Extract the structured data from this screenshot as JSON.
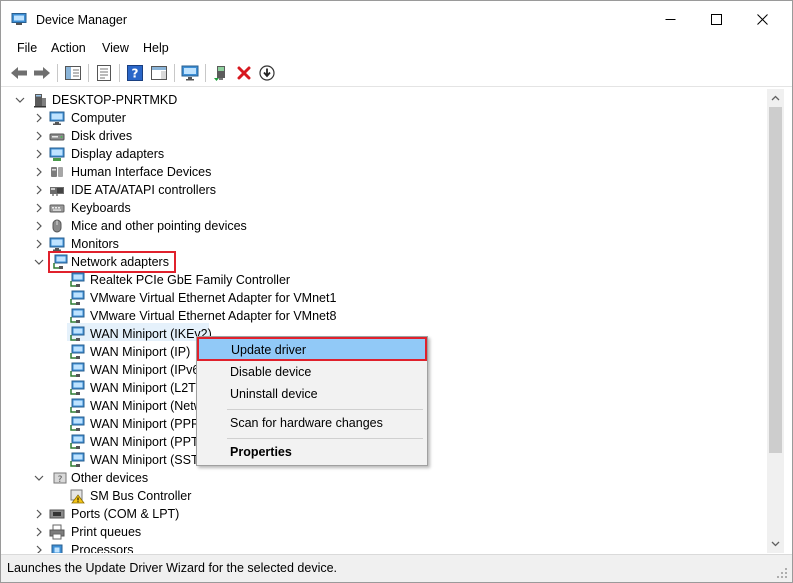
{
  "window": {
    "title": "Device Manager",
    "app_icon": "device-manager-icon"
  },
  "menu": [
    "File",
    "Action",
    "View",
    "Help"
  ],
  "toolbar": [
    "back-icon",
    "forward-icon",
    "show-hide-console-tree-icon",
    "properties-icon",
    "help-icon",
    "action-pane-icon",
    "monitor-icon",
    "update-driver-icon",
    "uninstall-icon",
    "download-icon"
  ],
  "tree": {
    "root": "DESKTOP-PNRTMKD",
    "categories": [
      "Computer",
      "Disk drives",
      "Display adapters",
      "Human Interface Devices",
      "IDE ATA/ATAPI controllers",
      "Keyboards",
      "Mice and other pointing devices",
      "Monitors"
    ],
    "network_adapters": {
      "label": "Network adapters",
      "children": [
        "Realtek PCIe GbE Family Controller",
        "VMware Virtual Ethernet Adapter for VMnet1",
        "VMware Virtual Ethernet Adapter for VMnet8",
        "WAN Miniport (IKEv2)",
        "WAN Miniport (IP)",
        "WAN Miniport (IPv6",
        "WAN Miniport (L2TP",
        "WAN Miniport (Netw",
        "WAN Miniport (PPP",
        "WAN Miniport (PPT",
        "WAN Miniport (SSTP"
      ]
    },
    "other_devices": {
      "label": "Other devices",
      "children": [
        "SM Bus Controller"
      ]
    },
    "after": [
      "Ports (COM & LPT)",
      "Print queues",
      "Processors"
    ]
  },
  "context_menu": {
    "items": [
      "Update driver",
      "Disable device",
      "Uninstall device",
      "Scan for hardware changes",
      "Properties"
    ]
  },
  "status": {
    "text": "Launches the Update Driver Wizard for the selected device."
  },
  "colors": {
    "highlight_border": "#e0212c",
    "menu_hover": "#91c9f7",
    "selection": "#e5f1fb"
  }
}
